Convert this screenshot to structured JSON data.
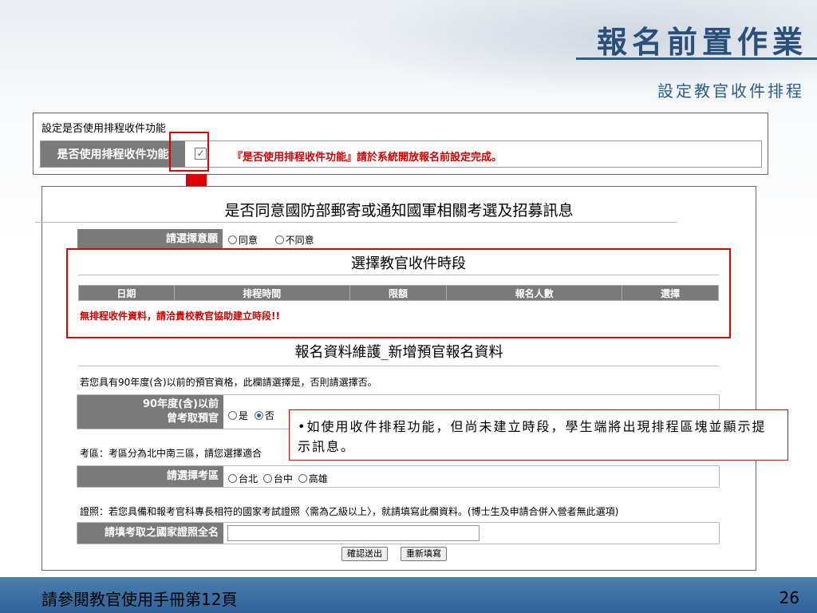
{
  "header": {
    "title": "報名前置作業",
    "subtitle": "設定教官收件排程"
  },
  "schedule_setting": {
    "label": "設定是否使用排程收件功能",
    "row_label": "是否使用排程收件功能",
    "note": "『是否使用排程收件功能』請於系統開放報名前設定完成。"
  },
  "consent": {
    "heading": "是否同意國防部郵寄或通知國軍相關考選及招募訊息",
    "row_label": "請選擇意願",
    "options": [
      "同意",
      "不同意"
    ]
  },
  "period": {
    "heading": "選擇教官收件時段",
    "columns": [
      "日期",
      "排程時間",
      "限額",
      "報名人數",
      "選擇"
    ],
    "empty_message": "無排程收件資料，請洽貴校教官協助建立時段!!"
  },
  "maintenance": {
    "heading": "報名資料維護_新增預官報名資料",
    "q1_text": "若您具有90年度(含)以前的預官資格，此欄請選擇是，否則請選擇否。",
    "q1_label_line1": "90年度(含)以前",
    "q1_label_line2": "曾考取預官",
    "q1_options": [
      "是",
      "否"
    ],
    "region_text": "考區：考區分為北中南三區，請您選擇適合",
    "region_label": "請選擇考區",
    "region_options": [
      "台北",
      "台中",
      "高雄"
    ],
    "cert_text": "證照：若您具備和報考官科專長相符的國家考試證照〈需為乙級以上〉，就請填寫此欄資料。(博士生及申請合併入營者無此選項)",
    "cert_label": "請填考取之國家證照全名",
    "cert_value": "",
    "submit_label": "確認送出",
    "reset_label": "重新填寫"
  },
  "callout": {
    "text": "•如使用收件排程功能，但尚未建立時段，學生端將出現排程區塊並顯示提示訊息。"
  },
  "footer": {
    "text": "請參閱教官使用手冊第12頁",
    "page": "26"
  },
  "colors": {
    "accent": "#2a5d8f",
    "highlight": "#e00000",
    "header_cell": "#7a7a7a"
  }
}
